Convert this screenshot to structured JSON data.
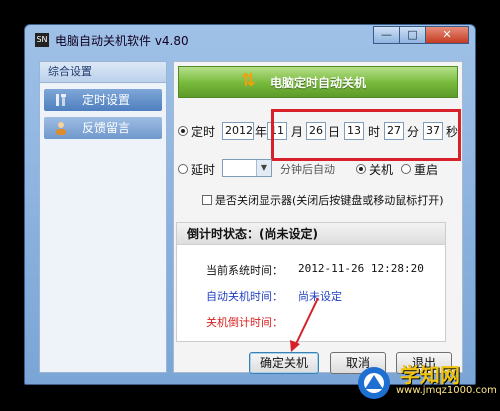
{
  "window": {
    "title": "电脑自动关机软件 v4.80",
    "app_icon": "SN"
  },
  "window_controls": {
    "minimize": "—",
    "maximize": "□",
    "close": "✕"
  },
  "sidebar": {
    "header": "综合设置",
    "items": [
      {
        "label": "定时设置",
        "icon": "wrench-screwdriver-icon"
      },
      {
        "label": "反馈留言",
        "icon": "user-icon"
      }
    ]
  },
  "banner": {
    "title": "电脑定时自动关机"
  },
  "timer": {
    "label": "定时",
    "year": "2012",
    "year_unit": "年",
    "month": "11",
    "month_unit": "月",
    "day": "26",
    "day_unit": "日",
    "hour": "13",
    "hour_unit": "时",
    "minute": "27",
    "minute_unit": "分",
    "second": "37",
    "second_unit": "秒"
  },
  "delay": {
    "label": "延时",
    "value": "",
    "suffix": "分钟后自动",
    "shutdown_label": "关机",
    "restart_label": "重启"
  },
  "monitor_checkbox": {
    "label": "是否关闭显示器(关闭后按键盘或移动鼠标打开)"
  },
  "status": {
    "header": "倒计时状态：(尚未设定)",
    "system_time_label": "当前系统时间：",
    "system_time_value": "2012-11-26 12:28:20",
    "auto_shutdown_label": "自动关机时间：",
    "auto_shutdown_value": "尚未设定",
    "countdown_label": "关机倒计时间："
  },
  "buttons": {
    "confirm": "确定关机",
    "cancel": "取消",
    "exit": "退出"
  },
  "watermark": {
    "text": "学知网",
    "url": "www.jmqz1000.com"
  },
  "colors": {
    "highlight": "#d7202a",
    "banner": "#76b83a",
    "link_blue": "#1f3fbf",
    "link_red": "#d81e1e"
  }
}
